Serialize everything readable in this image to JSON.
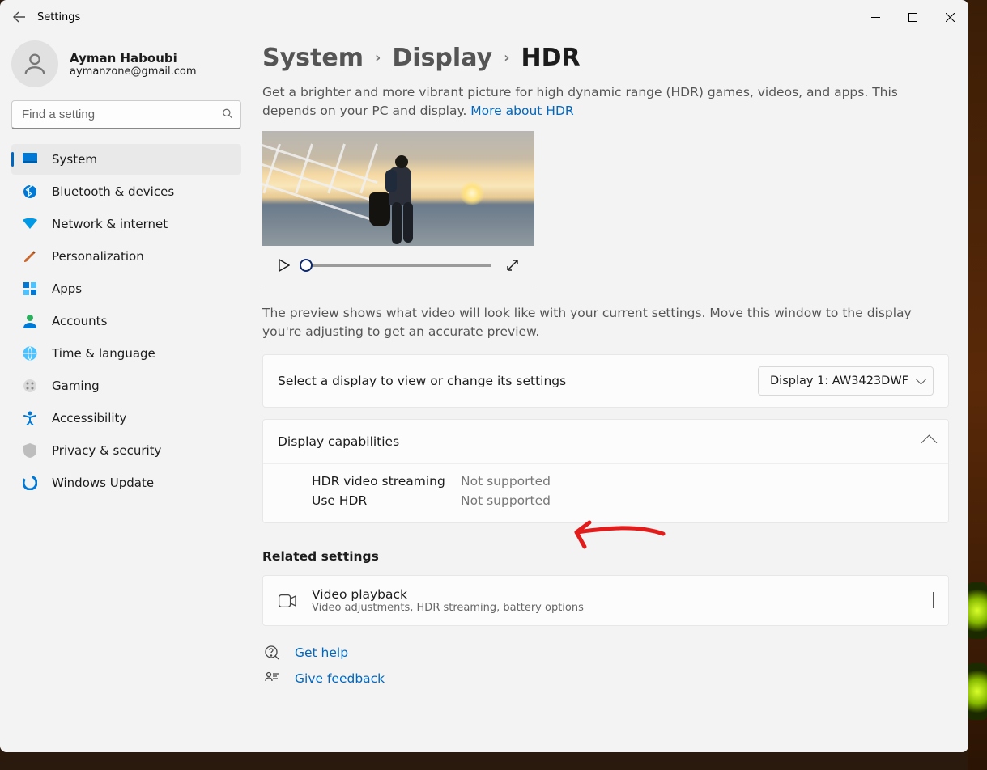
{
  "app_title": "Settings",
  "profile": {
    "name": "Ayman Haboubi",
    "email": "aymanzone@gmail.com"
  },
  "search": {
    "placeholder": "Find a setting"
  },
  "sidebar": {
    "items": [
      {
        "label": "System",
        "icon": "monitor-icon",
        "active": true
      },
      {
        "label": "Bluetooth & devices",
        "icon": "bluetooth-icon"
      },
      {
        "label": "Network & internet",
        "icon": "wifi-icon"
      },
      {
        "label": "Personalization",
        "icon": "brush-icon"
      },
      {
        "label": "Apps",
        "icon": "apps-icon"
      },
      {
        "label": "Accounts",
        "icon": "person-icon"
      },
      {
        "label": "Time & language",
        "icon": "globe-icon"
      },
      {
        "label": "Gaming",
        "icon": "gamepad-icon"
      },
      {
        "label": "Accessibility",
        "icon": "accessibility-icon"
      },
      {
        "label": "Privacy & security",
        "icon": "shield-icon"
      },
      {
        "label": "Windows Update",
        "icon": "update-icon"
      }
    ]
  },
  "breadcrumb": {
    "root": "System",
    "mid": "Display",
    "leaf": "HDR"
  },
  "intro": {
    "text": "Get a brighter and more vibrant picture for high dynamic range (HDR) games, videos, and apps. This depends on your PC and display. ",
    "link": "More about HDR"
  },
  "preview_hint": "The preview shows what video will look like with your current settings. Move this window to the display you're adjusting to get an accurate preview.",
  "display_select": {
    "label": "Select a display to view or change its settings",
    "value": "Display 1: AW3423DWF"
  },
  "capabilities": {
    "title": "Display capabilities",
    "rows": [
      {
        "label": "HDR video streaming",
        "value": "Not supported"
      },
      {
        "label": "Use HDR",
        "value": "Not supported"
      }
    ]
  },
  "related": {
    "title": "Related settings",
    "item": {
      "title": "Video playback",
      "subtitle": "Video adjustments, HDR streaming, battery options"
    }
  },
  "help_links": {
    "get_help": "Get help",
    "feedback": "Give feedback"
  }
}
